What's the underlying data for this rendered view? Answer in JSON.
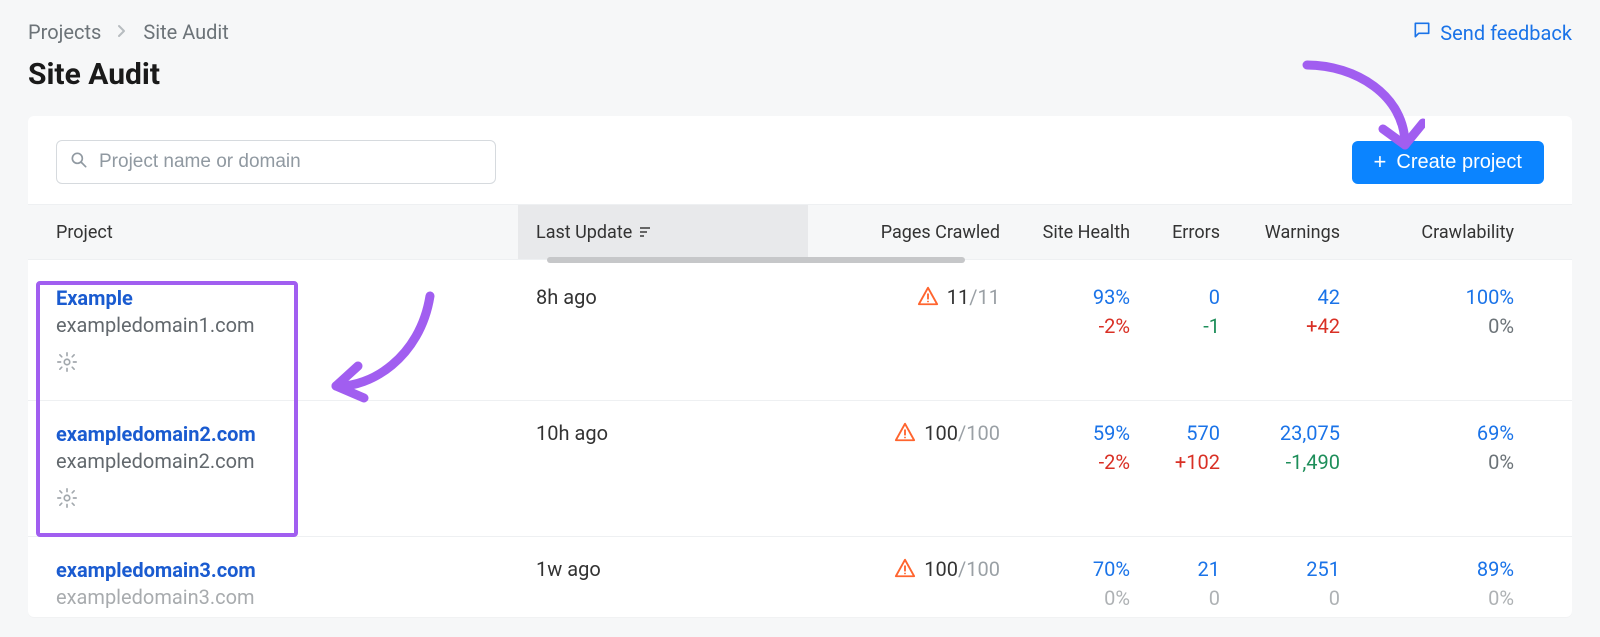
{
  "breadcrumb": {
    "root": "Projects",
    "current": "Site Audit"
  },
  "feedback_label": "Send feedback",
  "page_title": "Site Audit",
  "search": {
    "placeholder": "Project name or domain"
  },
  "create_button": "Create project",
  "columns": {
    "project": "Project",
    "last_update": "Last Update",
    "pages_crawled": "Pages Crawled",
    "site_health": "Site Health",
    "errors": "Errors",
    "warnings": "Warnings",
    "crawlability": "Crawlability"
  },
  "rows": [
    {
      "name": "Example",
      "domain": "exampledomain1.com",
      "last_update": "8h ago",
      "pages": "11",
      "pages_total": "/11",
      "health": "93%",
      "health_delta": "-2%",
      "errors": "0",
      "errors_delta": "-1",
      "warnings": "42",
      "warnings_delta": "+42",
      "crawl": "100%",
      "crawl_delta": "0%"
    },
    {
      "name": "exampledomain2.com",
      "domain": "exampledomain2.com",
      "last_update": "10h ago",
      "pages": "100",
      "pages_total": "/100",
      "health": "59%",
      "health_delta": "-2%",
      "errors": "570",
      "errors_delta": "+102",
      "warnings": "23,075",
      "warnings_delta": "-1,490",
      "crawl": "69%",
      "crawl_delta": "0%"
    },
    {
      "name": "exampledomain3.com",
      "domain": "exampledomain3.com",
      "last_update": "1w ago",
      "pages": "100",
      "pages_total": "/100",
      "health": "70%",
      "health_delta": "0%",
      "errors": "21",
      "errors_delta": "0",
      "warnings": "251",
      "warnings_delta": "0",
      "crawl": "89%",
      "crawl_delta": "0%"
    }
  ]
}
